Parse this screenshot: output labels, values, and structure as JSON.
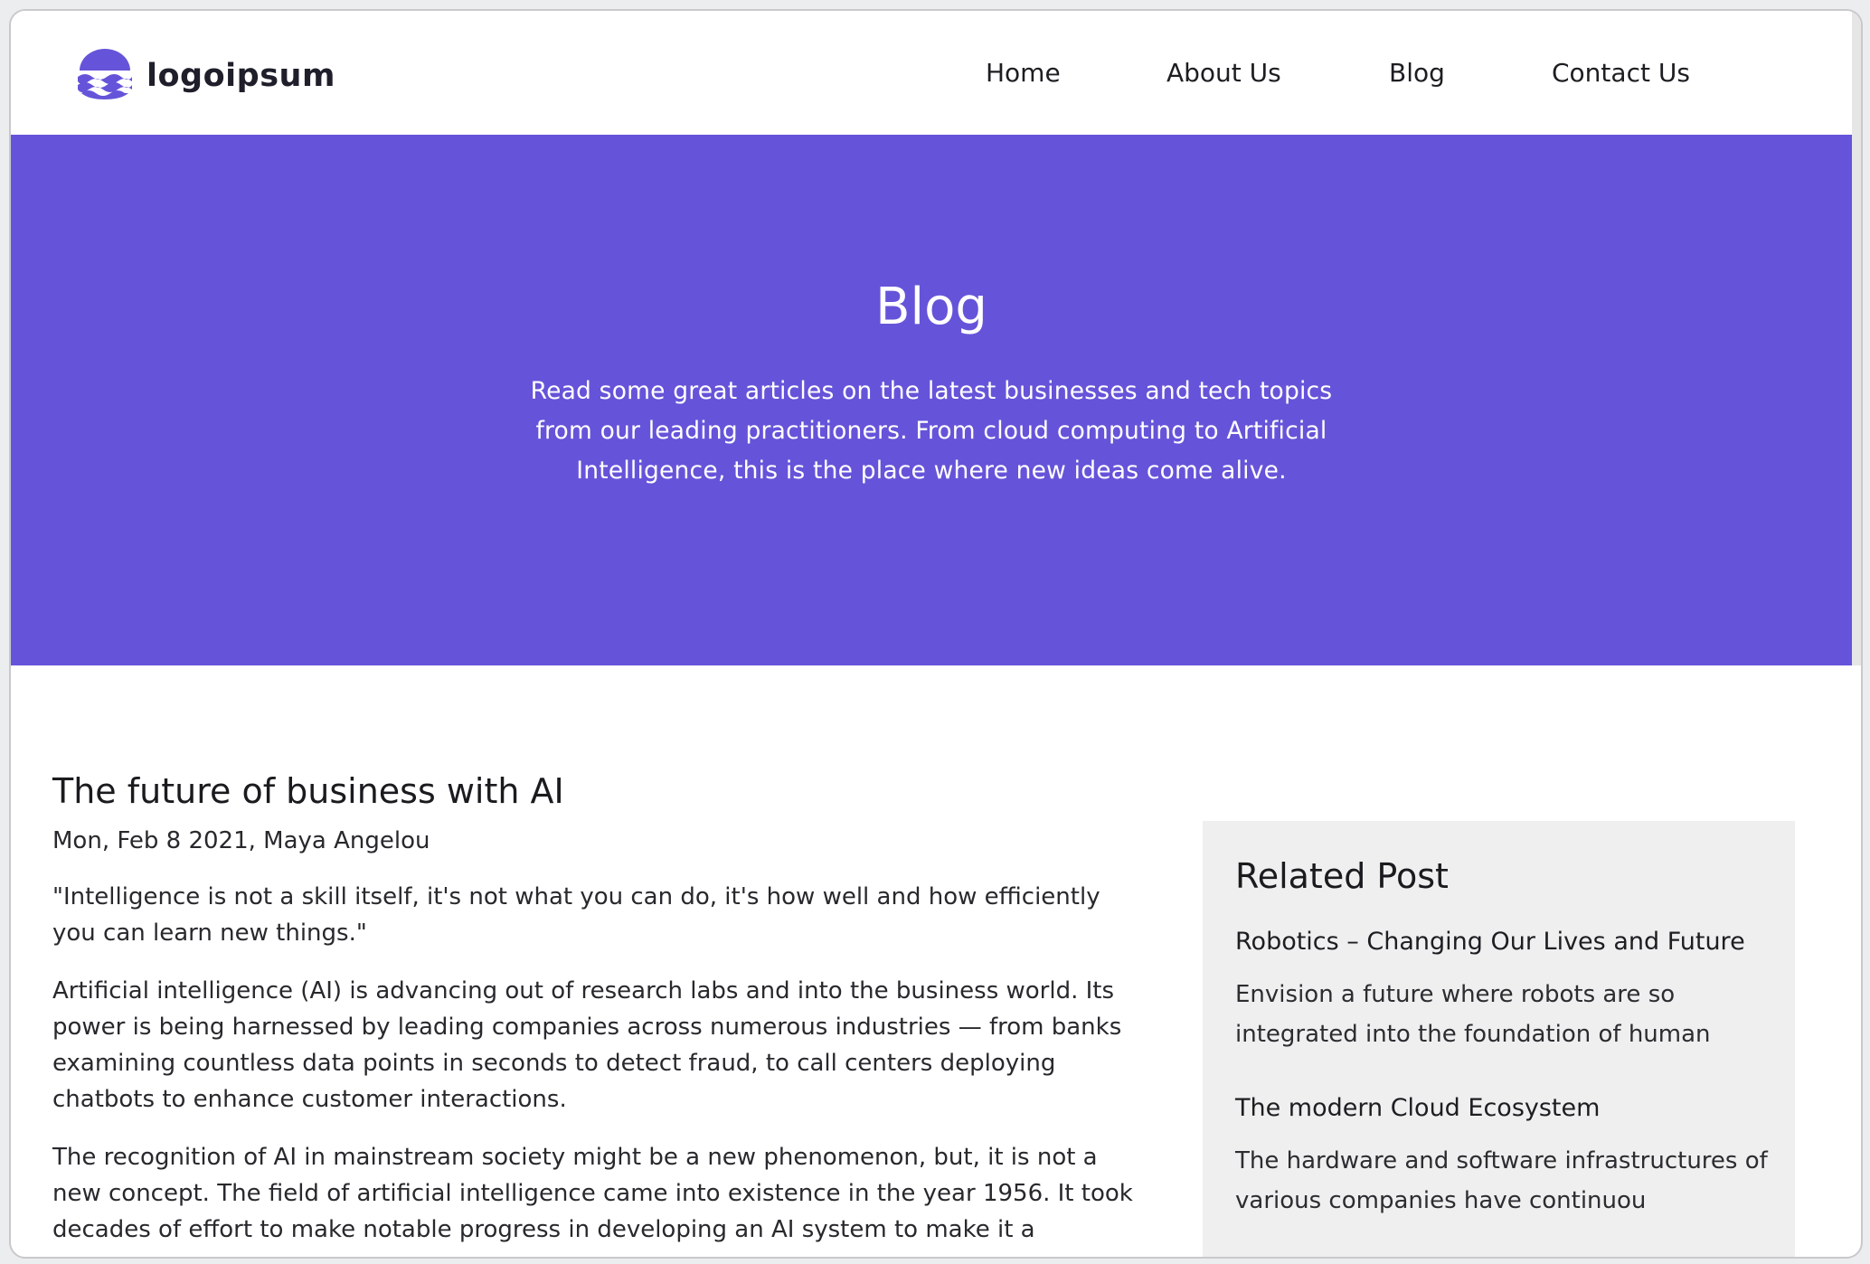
{
  "colors": {
    "accent": "#6554d9",
    "page_background": "#ffffff",
    "sidebar_background": "#efefef",
    "text": "#28282d"
  },
  "header": {
    "logo_text": "logoipsum",
    "logo_icon": "waves-logo-icon",
    "nav": [
      {
        "label": "Home"
      },
      {
        "label": "About Us"
      },
      {
        "label": "Blog"
      },
      {
        "label": "Contact Us"
      }
    ]
  },
  "hero": {
    "title": "Blog",
    "description": "Read some great articles on the latest businesses and tech topics from our leading practitioners. From cloud computing to Artificial Intelligence, this is the place where new ideas come alive."
  },
  "article": {
    "title": "The future of business with AI",
    "meta": "Mon, Feb 8 2021, Maya Angelou",
    "paragraphs": [
      "\"Intelligence is not a skill itself, it's not what you can do, it's how well and how efficiently you can learn new things.\"",
      "Artificial intelligence (AI) is advancing out of research labs and into the business world. Its power is being harnessed by leading companies across numerous industries — from banks examining countless data points in seconds to detect fraud, to call centers deploying chatbots to enhance customer interactions.",
      "The recognition of AI in mainstream society might be a new phenomenon, but, it is not a new concept. The field of artificial intelligence came into existence in the year 1956. It took decades of effort to make notable progress in developing an AI system to make it a"
    ]
  },
  "sidebar": {
    "title": "Related Post",
    "posts": [
      {
        "title": "Robotics – Changing Our Lives and Future",
        "excerpt": "Envision a future where robots are so integrated into the foundation of human"
      },
      {
        "title": "The modern Cloud Ecosystem",
        "excerpt": "The hardware and software infrastructures of various companies have continuou"
      }
    ]
  }
}
